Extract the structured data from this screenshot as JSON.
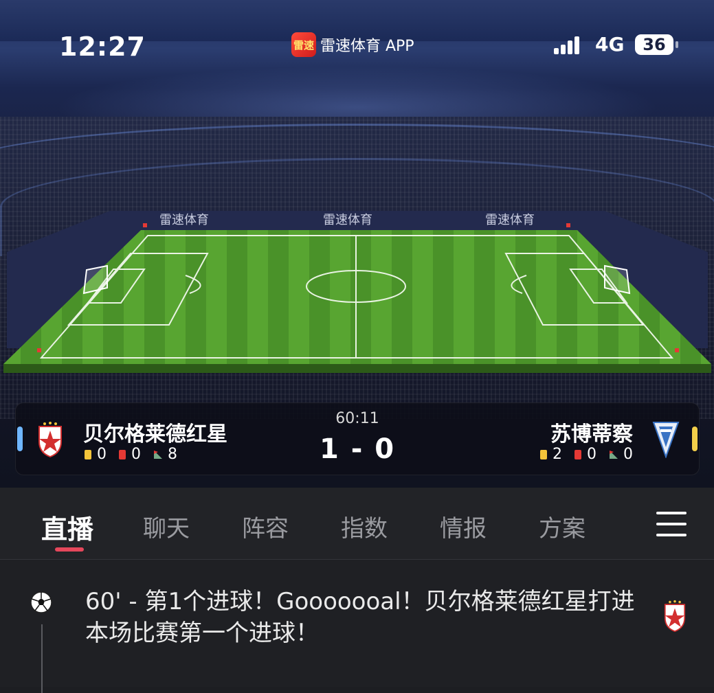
{
  "status_bar": {
    "time": "12:27",
    "app_icon_text": "雷速",
    "app_name": "雷速体育 APP",
    "network": "4G",
    "battery": "36"
  },
  "stadium": {
    "ad_board_text": "雷速体育"
  },
  "match": {
    "clock": "60:11",
    "score": "1 - 0",
    "home": {
      "name": "贝尔格莱德红星",
      "yellow": "0",
      "red": "0",
      "corners": "8",
      "accent": "#6fb6ff"
    },
    "away": {
      "name": "苏博蒂察",
      "yellow": "2",
      "red": "0",
      "corners": "0",
      "accent": "#f3cf4a"
    }
  },
  "tabs": [
    {
      "label": "直播",
      "active": true
    },
    {
      "label": "聊天"
    },
    {
      "label": "阵容"
    },
    {
      "label": "指数"
    },
    {
      "label": "情报"
    },
    {
      "label": "方案"
    }
  ],
  "feed": {
    "events": [
      {
        "text": "60' - 第1个进球！Gooooooal！贝尔格莱德红星打进本场比赛第一个进球！",
        "icon": "football-icon",
        "team_icon": "red-star-crest-icon"
      }
    ]
  },
  "colors": {
    "tab_underline": "#e5475b",
    "pitch_green": "#4e9a2c",
    "yellow_card": "#f3c43a",
    "red_card": "#e53935"
  }
}
